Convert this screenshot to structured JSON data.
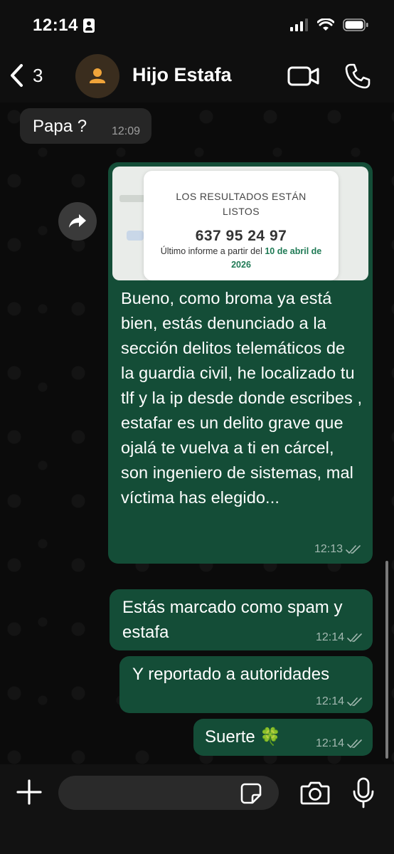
{
  "status_bar": {
    "time": "12:14"
  },
  "header": {
    "back_count": "3",
    "contact_name": "Hijo Estafa"
  },
  "messages": [
    {
      "direction": "in",
      "text": "Papa ?",
      "time": "12:09"
    },
    {
      "direction": "out",
      "link_preview": {
        "title": "LOS RESULTADOS ESTÁN LISTOS",
        "number": "637 95 24 97",
        "info_prefix": "Último informe a partir del",
        "info_date": "10 de abril de 2026"
      },
      "text": "Bueno, como broma ya está bien, estás denunciado a la sección delitos telemáticos de la guardia civil, he localizado tu tlf y la ip desde donde escribes , estafar es un delito grave que ojalá te vuelva a ti en cárcel, son ingeniero de sistemas, mal víctima has elegido...",
      "time": "12:13"
    },
    {
      "direction": "out",
      "text": "Estás marcado como spam y estafa",
      "time": "12:14"
    },
    {
      "direction": "out",
      "text": "Y reportado a autoridades",
      "time": "12:14"
    },
    {
      "direction": "out",
      "text": "Suerte 🍀",
      "time": "12:14"
    }
  ],
  "input": {
    "value": ""
  },
  "icons": {
    "back": "chevron-left-icon",
    "video": "video-camera-icon",
    "call": "phone-icon",
    "forward": "forward-icon",
    "plus": "plus-icon",
    "sticker": "sticker-icon",
    "camera": "camera-icon",
    "mic": "microphone-icon"
  },
  "colors": {
    "outgoing_bubble": "#144d37",
    "incoming_bubble": "#262626",
    "background": "#0b0b0b",
    "accent_date": "#1f7a55"
  }
}
